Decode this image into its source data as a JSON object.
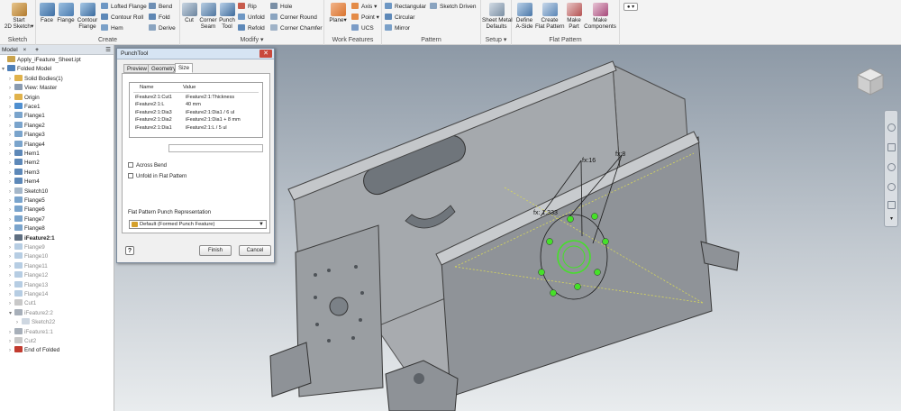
{
  "ribbon": {
    "sketch_group": {
      "label": "Sketch",
      "start_sketch": "Start\n2D Sketch"
    },
    "create_group": {
      "label": "Create",
      "face": "Face",
      "flange": "Flange",
      "contour_flange": "Contour\nFlange",
      "lofted_flange": "Lofted Flange",
      "contour_roll": "Contour Roll",
      "hem": "Hem",
      "bend": "Bend",
      "fold": "Fold",
      "derive": "Derive"
    },
    "modify_group": {
      "label": "Modify",
      "cut": "Cut",
      "corner_seam": "Corner\nSeam",
      "punch_tool": "Punch\nTool",
      "rip": "Rip",
      "unfold": "Unfold",
      "refold": "Refold",
      "hole": "Hole",
      "corner_round": "Corner Round",
      "corner_chamfer": "Corner Chamfer"
    },
    "work_features_group": {
      "label": "Work Features",
      "plane": "Plane",
      "axis": "Axis",
      "point": "Point",
      "ucs": "UCS"
    },
    "pattern_group": {
      "label": "Pattern",
      "rectangular": "Rectangular",
      "circular": "Circular",
      "mirror": "Mirror",
      "sketch_driven": "Sketch Driven"
    },
    "setup_group": {
      "label": "Setup",
      "sheet_metal_defaults": "Sheet Metal\nDefaults"
    },
    "flat_pattern_group": {
      "label": "Flat Pattern",
      "define_a_side": "Define\nA-Side",
      "create_flat_pattern": "Create\nFlat Pattern",
      "make_part": "Make\nPart",
      "make_components": "Make\nComponents"
    }
  },
  "browser": {
    "tabs": [
      "Model",
      "×",
      "+"
    ],
    "items": [
      {
        "label": "Apply_iFeature_Sheet.ipt",
        "level": 0,
        "icon": "part-icon",
        "style": ""
      },
      {
        "label": "Folded Model",
        "level": 0,
        "icon": "folded-model-icon",
        "style": "",
        "expanded": true
      },
      {
        "label": "Solid Bodies(1)",
        "level": 1,
        "icon": "folder-icon",
        "style": ""
      },
      {
        "label": "View: Master",
        "level": 1,
        "icon": "view-icon",
        "style": ""
      },
      {
        "label": "Origin",
        "level": 1,
        "icon": "folder-icon",
        "style": ""
      },
      {
        "label": "Face1",
        "level": 1,
        "icon": "face-icon",
        "style": ""
      },
      {
        "label": "Flange1",
        "level": 1,
        "icon": "flange-icon",
        "style": ""
      },
      {
        "label": "Flange2",
        "level": 1,
        "icon": "flange-icon",
        "style": ""
      },
      {
        "label": "Flange3",
        "level": 1,
        "icon": "flange-icon",
        "style": ""
      },
      {
        "label": "Flange4",
        "level": 1,
        "icon": "flange-icon",
        "style": ""
      },
      {
        "label": "Hem1",
        "level": 1,
        "icon": "hem-icon",
        "style": ""
      },
      {
        "label": "Hem2",
        "level": 1,
        "icon": "hem-icon",
        "style": ""
      },
      {
        "label": "Hem3",
        "level": 1,
        "icon": "hem-icon",
        "style": ""
      },
      {
        "label": "Hem4",
        "level": 1,
        "icon": "hem-icon",
        "style": ""
      },
      {
        "label": "Sketch10",
        "level": 1,
        "icon": "sketch-icon",
        "style": ""
      },
      {
        "label": "Flange5",
        "level": 1,
        "icon": "flange-icon",
        "style": ""
      },
      {
        "label": "Flange6",
        "level": 1,
        "icon": "flange-icon",
        "style": ""
      },
      {
        "label": "Flange7",
        "level": 1,
        "icon": "flange-icon",
        "style": ""
      },
      {
        "label": "Flange8",
        "level": 1,
        "icon": "flange-icon",
        "style": ""
      },
      {
        "label": "iFeature2:1",
        "level": 1,
        "icon": "ifeature-icon",
        "style": "bold"
      },
      {
        "label": "Flange9",
        "level": 1,
        "icon": "flange-icon",
        "style": "dim"
      },
      {
        "label": "Flange10",
        "level": 1,
        "icon": "flange-icon",
        "style": "dim"
      },
      {
        "label": "Flange11",
        "level": 1,
        "icon": "flange-icon",
        "style": "dim"
      },
      {
        "label": "Flange12",
        "level": 1,
        "icon": "flange-icon",
        "style": "dim"
      },
      {
        "label": "Flange13",
        "level": 1,
        "icon": "flange-icon",
        "style": "dim"
      },
      {
        "label": "Flange14",
        "level": 1,
        "icon": "flange-icon",
        "style": "dim"
      },
      {
        "label": "Cut1",
        "level": 1,
        "icon": "cut-icon",
        "style": "dim"
      },
      {
        "label": "iFeature2:2",
        "level": 1,
        "icon": "ifeature-icon",
        "style": "dim",
        "expanded": true
      },
      {
        "label": "Sketch22",
        "level": 2,
        "icon": "sketch-icon",
        "style": "dim"
      },
      {
        "label": "iFeature1:1",
        "level": 1,
        "icon": "ifeature-icon",
        "style": "dim"
      },
      {
        "label": "Cut2",
        "level": 1,
        "icon": "cut-icon",
        "style": "dim"
      },
      {
        "label": "End of Folded",
        "level": 1,
        "icon": "end-of-part-icon",
        "style": ""
      }
    ]
  },
  "dialog": {
    "title": "PunchTool",
    "close": "✕",
    "tabs": [
      "Preview",
      "Geometry",
      "Size"
    ],
    "active_tab": "Size",
    "table": {
      "headers": [
        "Name",
        "Value"
      ],
      "rows": [
        [
          "iFeature2:1:Cut1",
          "iFeature2:1:Thickness"
        ],
        [
          "iFeature2:1:L",
          "40 mm"
        ],
        [
          "iFeature2:1:Dia3",
          "iFeature2:1:Dia1 / 6 ul"
        ],
        [
          "iFeature2:1:Dia2",
          "iFeature2:1:Dia1 + 8 mm"
        ],
        [
          "iFeature2:1:Dia1",
          "iFeature2:1:L / 5 ul"
        ]
      ]
    },
    "across_bend": "Across Bend",
    "unfold_in_flat_pattern": "Unfold in Flat Pattern",
    "flat_pattern_punch_label": "Flat Pattern Punch Representation",
    "flat_pattern_punch_value": "Default (Formed Punch Feature)",
    "finish": "Finish",
    "cancel": "Cancel"
  },
  "viewport": {
    "dimensions": [
      "fx:16",
      "fx:8",
      "fx: 1.333"
    ],
    "colors": {
      "sheet_metal": "#9b9ea2",
      "sketch_highlight": "#46e02a",
      "background_top": "#8d99a6"
    }
  },
  "navbar": {
    "icons": [
      "steering-wheel-icon",
      "pan-icon",
      "zoom-icon",
      "orbit-icon",
      "look-at-icon",
      "more-icon"
    ]
  }
}
